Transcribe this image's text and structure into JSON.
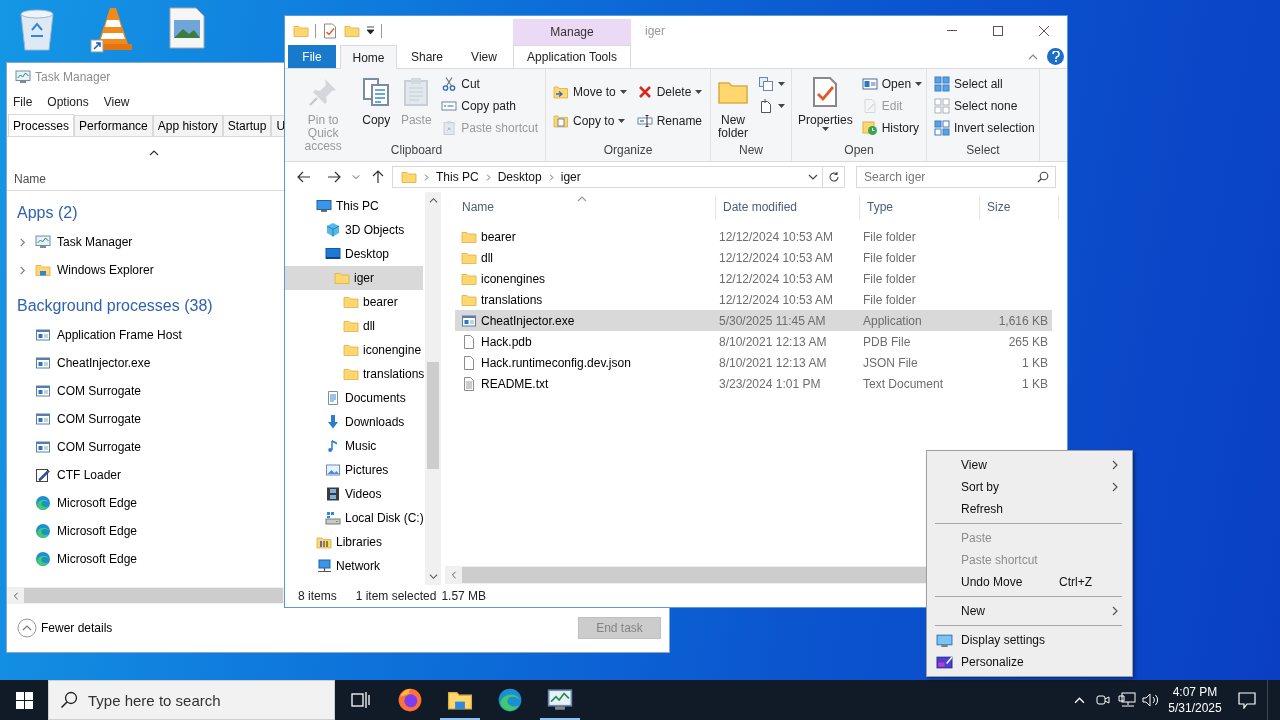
{
  "task_manager": {
    "title": "Task Manager",
    "menu": [
      "File",
      "Options",
      "View"
    ],
    "tabs": [
      {
        "label": "Processes",
        "selected": true
      },
      {
        "label": "Performance",
        "selected": false
      },
      {
        "label": "App history",
        "selected": false
      },
      {
        "label": "Startup",
        "selected": false
      },
      {
        "label": "U",
        "selected": false
      }
    ],
    "column": "Name",
    "groups": [
      {
        "title": "Apps (2)",
        "items": [
          {
            "name": "Task Manager",
            "kind": "taskmgr",
            "expanded": false
          },
          {
            "name": "Windows Explorer",
            "kind": "explorer",
            "expanded": false
          }
        ]
      },
      {
        "title": "Background processes (38)",
        "items": [
          {
            "name": "Application Frame Host",
            "kind": "window"
          },
          {
            "name": "CheatInjector.exe",
            "kind": "window"
          },
          {
            "name": "COM Surrogate",
            "kind": "window"
          },
          {
            "name": "COM Surrogate",
            "kind": "window"
          },
          {
            "name": "COM Surrogate",
            "kind": "window"
          },
          {
            "name": "CTF Loader",
            "kind": "ctf"
          },
          {
            "name": "Microsoft Edge",
            "kind": "edge"
          },
          {
            "name": "Microsoft Edge",
            "kind": "edge"
          },
          {
            "name": "Microsoft Edge",
            "kind": "edge"
          }
        ]
      }
    ],
    "footer": "Fewer details",
    "end_task": {
      "label": "End task",
      "disabled": true
    }
  },
  "explorer": {
    "title": "iger",
    "contextual_group": "Manage",
    "tabs": [
      {
        "label": "File",
        "kind": "file",
        "selected": false
      },
      {
        "label": "Home",
        "kind": "tab",
        "selected": true
      },
      {
        "label": "Share",
        "kind": "tab",
        "selected": false
      },
      {
        "label": "View",
        "kind": "tab",
        "selected": false
      },
      {
        "label": "Application Tools",
        "kind": "contextual",
        "selected": false
      }
    ],
    "ribbon": [
      {
        "label": "Clipboard",
        "columns": [
          {
            "kind": "large",
            "items": [
              {
                "label": "Pin to Quick access",
                "disabled": true,
                "dropdown": false
              }
            ]
          },
          {
            "kind": "large",
            "items": [
              {
                "label": "Copy",
                "disabled": false,
                "dropdown": false
              }
            ]
          },
          {
            "kind": "large",
            "items": [
              {
                "label": "Paste",
                "disabled": true,
                "dropdown": false
              }
            ]
          },
          {
            "kind": "stack",
            "items": [
              {
                "label": "Cut",
                "disabled": false,
                "dropdown": false
              },
              {
                "label": "Copy path",
                "disabled": false,
                "dropdown": false
              },
              {
                "label": "Paste shortcut",
                "disabled": true,
                "dropdown": false
              }
            ]
          }
        ]
      },
      {
        "label": "Organize",
        "columns": [
          {
            "kind": "stack",
            "items": [
              {
                "label": "Move to",
                "disabled": false,
                "dropdown": true
              },
              {
                "label": "Copy to",
                "disabled": false,
                "dropdown": true
              }
            ]
          },
          {
            "kind": "stack",
            "items": [
              {
                "label": "Delete",
                "disabled": false,
                "dropdown": true
              },
              {
                "label": "Rename",
                "disabled": false,
                "dropdown": false
              }
            ]
          }
        ]
      },
      {
        "label": "New",
        "columns": [
          {
            "kind": "large",
            "items": [
              {
                "label": "New folder",
                "disabled": false,
                "dropdown": false
              }
            ]
          },
          {
            "kind": "stack",
            "items": [
              {
                "disabled": false,
                "dropdown": true
              },
              {
                "disabled": false,
                "dropdown": true
              }
            ]
          }
        ]
      },
      {
        "label": "Open",
        "columns": [
          {
            "kind": "large",
            "items": [
              {
                "label": "Properties",
                "disabled": false,
                "dropdown": true
              }
            ]
          },
          {
            "kind": "stack",
            "items": [
              {
                "label": "Open",
                "disabled": false,
                "dropdown": true
              },
              {
                "label": "Edit",
                "disabled": true,
                "dropdown": false
              },
              {
                "label": "History",
                "disabled": false,
                "dropdown": false
              }
            ]
          }
        ]
      },
      {
        "label": "Select",
        "columns": [
          {
            "kind": "stack",
            "items": [
              {
                "label": "Select all",
                "disabled": false,
                "dropdown": false
              },
              {
                "label": "Select none",
                "disabled": false,
                "dropdown": false
              },
              {
                "label": "Invert selection",
                "disabled": false,
                "dropdown": false
              }
            ]
          }
        ]
      }
    ],
    "address": [
      "This PC",
      "Desktop",
      "iger"
    ],
    "search": {
      "placeholder": "Search iger"
    },
    "nav": [
      {
        "label": "This PC",
        "kind": "pc",
        "selected": false,
        "children": [
          {
            "label": "3D Objects",
            "kind": "objects",
            "selected": false
          },
          {
            "label": "Desktop",
            "kind": "desktop",
            "selected": false,
            "children": [
              {
                "label": "iger",
                "kind": "folder",
                "selected": true,
                "children": [
                  {
                    "label": "bearer",
                    "kind": "folder",
                    "selected": false
                  },
                  {
                    "label": "dll",
                    "kind": "folder",
                    "selected": false
                  },
                  {
                    "label": "iconengine",
                    "kind": "folder",
                    "selected": false
                  },
                  {
                    "label": "translations",
                    "kind": "folder",
                    "selected": false
                  }
                ]
              }
            ]
          },
          {
            "label": "Documents",
            "kind": "documents",
            "selected": false
          },
          {
            "label": "Downloads",
            "kind": "downloads",
            "selected": false
          },
          {
            "label": "Music",
            "kind": "music",
            "selected": false
          },
          {
            "label": "Pictures",
            "kind": "pictures",
            "selected": false
          },
          {
            "label": "Videos",
            "kind": "videos",
            "selected": false
          },
          {
            "label": "Local Disk (C:)",
            "kind": "disk",
            "selected": false
          }
        ]
      },
      {
        "label": "Libraries",
        "kind": "libraries",
        "selected": false
      },
      {
        "label": "Network",
        "kind": "network",
        "selected": false
      }
    ],
    "columns": [
      "Name",
      "Date modified",
      "Type",
      "Size"
    ],
    "files": [
      {
        "name": "bearer",
        "date": "12/12/2024 10:53 AM",
        "type": "File folder",
        "kind": "folder",
        "selected": false
      },
      {
        "name": "dll",
        "date": "12/12/2024 10:53 AM",
        "type": "File folder",
        "kind": "folder",
        "selected": false
      },
      {
        "name": "iconengines",
        "date": "12/12/2024 10:53 AM",
        "type": "File folder",
        "kind": "folder",
        "selected": false
      },
      {
        "name": "translations",
        "date": "12/12/2024 10:53 AM",
        "type": "File folder",
        "kind": "folder",
        "selected": false
      },
      {
        "name": "CheatInjector.exe",
        "date": "5/30/2025 11:45 AM",
        "type": "Application",
        "size": "1,616 KB",
        "kind": "exe",
        "selected": true
      },
      {
        "name": "Hack.pdb",
        "date": "8/10/2021 12:13 AM",
        "type": "PDB File",
        "size": "265 KB",
        "kind": "file",
        "selected": false
      },
      {
        "name": "Hack.runtimeconfig.dev.json",
        "date": "8/10/2021 12:13 AM",
        "type": "JSON File",
        "size": "1 KB",
        "kind": "file",
        "selected": false
      },
      {
        "name": "README.txt",
        "date": "3/23/2024 1:01 PM",
        "type": "Text Document",
        "size": "1 KB",
        "kind": "text",
        "selected": false
      }
    ],
    "status": {
      "count": "8 items",
      "selection": "1 item selected",
      "size": "1.57 MB"
    }
  },
  "context_menu": [
    {
      "kind": "submenu",
      "label": "View",
      "disabled": false
    },
    {
      "kind": "submenu",
      "label": "Sort by",
      "disabled": false
    },
    {
      "kind": "command",
      "label": "Refresh",
      "disabled": false
    },
    {
      "kind": "separator"
    },
    {
      "kind": "command",
      "label": "Paste",
      "disabled": true
    },
    {
      "kind": "command",
      "label": "Paste shortcut",
      "disabled": true
    },
    {
      "kind": "command",
      "label": "Undo Move",
      "shortcut": "Ctrl+Z",
      "disabled": false
    },
    {
      "kind": "separator"
    },
    {
      "kind": "submenu",
      "label": "New",
      "disabled": false
    },
    {
      "kind": "separator"
    },
    {
      "kind": "display",
      "label": "Display settings",
      "disabled": false
    },
    {
      "kind": "personalize",
      "label": "Personalize",
      "disabled": false
    }
  ],
  "taskbar": {
    "search_placeholder": "Type here to search",
    "apps": [
      {
        "kind": "firefox",
        "open": false
      },
      {
        "kind": "explorer",
        "open": true
      },
      {
        "kind": "edge",
        "open": false
      },
      {
        "kind": "taskmgr",
        "open": true
      }
    ],
    "time": "4:07 PM",
    "date": "5/31/2025"
  }
}
